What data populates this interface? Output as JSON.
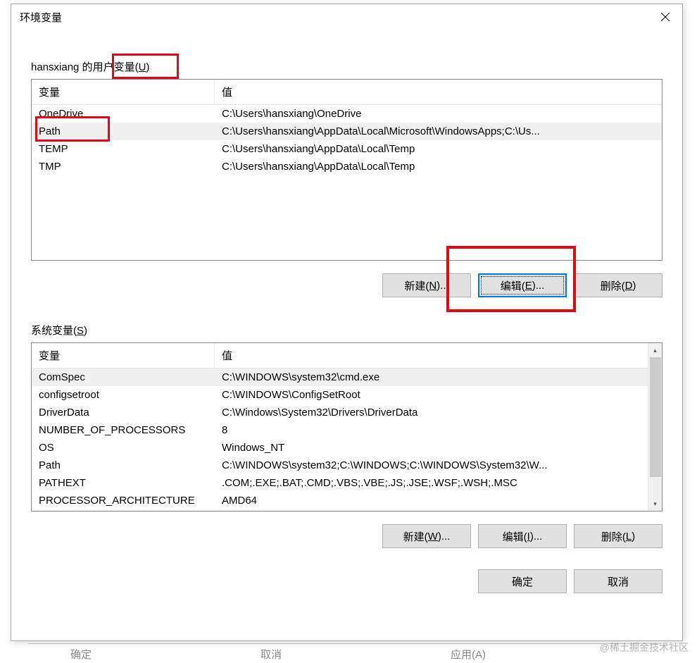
{
  "window": {
    "title": "环境变量"
  },
  "user_section": {
    "label_prefix": "hansxiang 的",
    "label_main": "用户变量(",
    "label_key": "U",
    "label_suffix": ")",
    "columns": {
      "name": "变量",
      "value": "值"
    },
    "rows": [
      {
        "name": "OneDrive",
        "value": "C:\\Users\\hansxiang\\OneDrive",
        "selected": false
      },
      {
        "name": "Path",
        "value": "C:\\Users\\hansxiang\\AppData\\Local\\Microsoft\\WindowsApps;C:\\Us...",
        "selected": true
      },
      {
        "name": "TEMP",
        "value": "C:\\Users\\hansxiang\\AppData\\Local\\Temp",
        "selected": false
      },
      {
        "name": "TMP",
        "value": "C:\\Users\\hansxiang\\AppData\\Local\\Temp",
        "selected": false
      }
    ],
    "buttons": {
      "new_l": "新建(",
      "new_k": "N",
      "new_r": ")...",
      "edit_l": "编辑(",
      "edit_k": "E",
      "edit_r": ")...",
      "del_l": "删除(",
      "del_k": "D",
      "del_r": ")"
    }
  },
  "sys_section": {
    "label_main": "系统变量(",
    "label_key": "S",
    "label_suffix": ")",
    "columns": {
      "name": "变量",
      "value": "值"
    },
    "rows": [
      {
        "name": "ComSpec",
        "value": "C:\\WINDOWS\\system32\\cmd.exe",
        "selected": true
      },
      {
        "name": "configsetroot",
        "value": "C:\\WINDOWS\\ConfigSetRoot",
        "selected": false
      },
      {
        "name": "DriverData",
        "value": "C:\\Windows\\System32\\Drivers\\DriverData",
        "selected": false
      },
      {
        "name": "NUMBER_OF_PROCESSORS",
        "value": "8",
        "selected": false
      },
      {
        "name": "OS",
        "value": "Windows_NT",
        "selected": false
      },
      {
        "name": "Path",
        "value": "C:\\WINDOWS\\system32;C:\\WINDOWS;C:\\WINDOWS\\System32\\W...",
        "selected": false
      },
      {
        "name": "PATHEXT",
        "value": ".COM;.EXE;.BAT;.CMD;.VBS;.VBE;.JS;.JSE;.WSF;.WSH;.MSC",
        "selected": false
      },
      {
        "name": "PROCESSOR_ARCHITECTURE",
        "value": "AMD64",
        "selected": false
      }
    ],
    "buttons": {
      "new_l": "新建(",
      "new_k": "W",
      "new_r": ")...",
      "edit_l": "编辑(",
      "edit_k": "I",
      "edit_r": ")...",
      "del_l": "删除(",
      "del_k": "L",
      "del_r": ")"
    }
  },
  "dialog_buttons": {
    "ok": "确定",
    "cancel": "取消"
  },
  "bg": {
    "ok": "确定",
    "cancel": "取消",
    "apply": "应用(A)"
  },
  "watermark": "@稀土掘金技术社区"
}
